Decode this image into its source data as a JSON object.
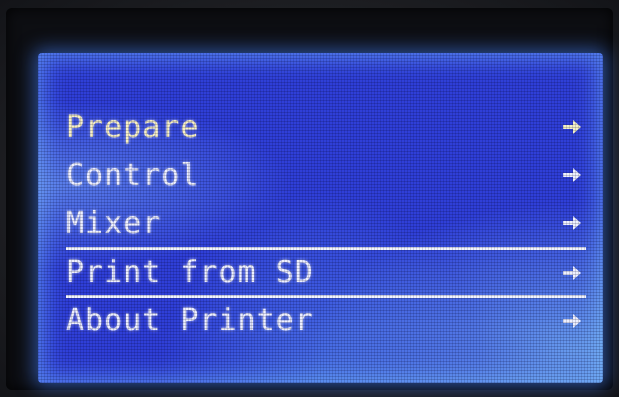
{
  "screen": {
    "menu": {
      "items": [
        {
          "label": "Prepare",
          "icon": "arrow-right-icon"
        },
        {
          "label": "Control",
          "icon": "arrow-right-icon"
        },
        {
          "label": "Mixer",
          "icon": "arrow-right-icon"
        },
        {
          "label": "Print from SD",
          "icon": "arrow-right-icon",
          "selected": true
        },
        {
          "label": "About Printer",
          "icon": "arrow-right-icon"
        }
      ]
    }
  },
  "colors": {
    "lcd_background": "#2f3fd8",
    "text": "#eef0ff",
    "backlight_glow": "#78beff"
  }
}
